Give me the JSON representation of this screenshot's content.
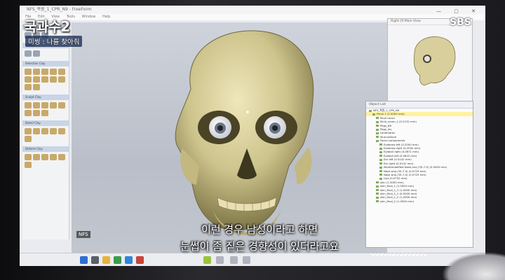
{
  "overlay": {
    "logo": "국과수2",
    "episode": "미씽 : 나를 찾아줘",
    "broadcaster": "SBS",
    "nfs_badge": "NFS"
  },
  "subtitle": {
    "line1": "이런 경우 남성이라고 하면",
    "line2": "눈썹이 좀 짙은 경향성이 있더라고요"
  },
  "app": {
    "title": "NFS_복원_1_CPR_N9 - FreeForm",
    "menus": [
      "File",
      "Edit",
      "View",
      "Tools",
      "Window",
      "Help"
    ],
    "toolbox_sections": [
      "Select",
      "Sketch",
      "Selection Clay",
      "Sculpt Clay",
      "Detail Clay",
      "Deform Clay"
    ],
    "side_view_title": "Right Of Main View",
    "object_list_title": "Object List",
    "objects": [
      "NFS_복원_1_CPR_N9",
      "Piece 1 (2.0000 mm)",
      "Skull recon",
      "Skull_recon_1 (0.2132 mm)",
      "Pegs_N9",
      "Pegs_Ins",
      "Landmarks",
      "Musculature",
      "Facial components",
      "Eyebrow left (0.2000 mm)",
      "Eyebrow right (0.2000 mm)",
      "Eyeball right (0.0671 mm)",
      "Eyeball left (0.0622 mm)",
      "Ear left (0.0142 mm)",
      "Ear right (0.0142 mm)",
      "Mouthmodified Nose proj (35-7-0) (0.5000 mm)",
      "Nose proj (35-7-0) (0.0725 mm)",
      "Nose proj (35-7-0) (0.0725 mm)",
      "Lips (0.0752 mm)",
      "skin (1.0000 mm)",
      "skin_final_1 (1.0000 mm)",
      "skin_final_1_1 (1.0000 mm)",
      "skin_final_1_1 (0.0000 mm)",
      "skin_final_1_2 (1.0000 mm)",
      "skin_final_2 (1.0000 mm)"
    ],
    "selected_object": 1
  },
  "colors": {
    "bone": "#d8cf9c",
    "viewport_bg": "#c3c7cf",
    "subtitle": "#ffffff"
  }
}
